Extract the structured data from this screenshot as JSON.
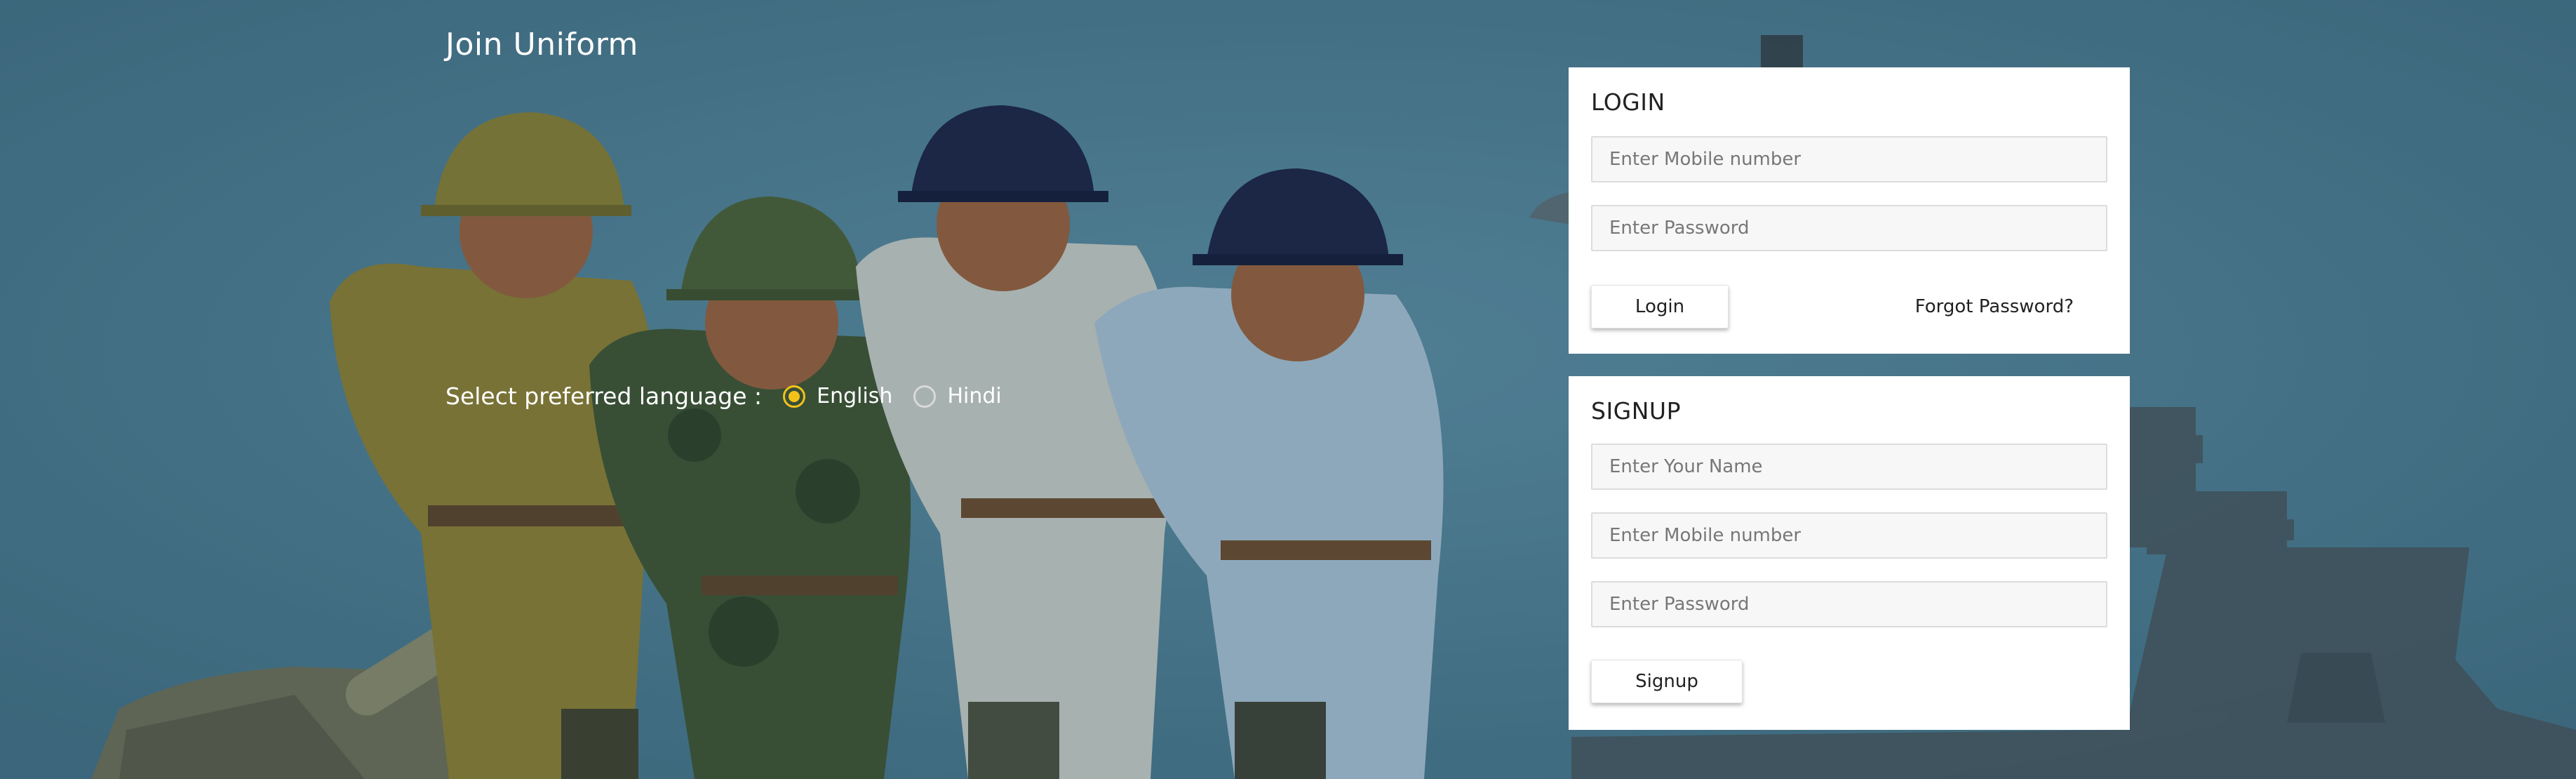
{
  "header": {
    "brand": "Join Uniform"
  },
  "language": {
    "label": "Select preferred language :",
    "options": [
      {
        "label": "English",
        "selected": true
      },
      {
        "label": "Hindi",
        "selected": false
      }
    ],
    "accent_color": "#f2c21b"
  },
  "login": {
    "title": "LOGIN",
    "mobile_placeholder": "Enter Mobile number",
    "password_placeholder": "Enter Password",
    "button_label": "Login",
    "forgot_label": "Forgot Password?"
  },
  "signup": {
    "title": "SIGNUP",
    "name_placeholder": "Enter Your Name",
    "mobile_placeholder": "Enter Mobile number",
    "password_placeholder": "Enter Password",
    "button_label": "Signup"
  },
  "colors": {
    "background": "#4e7a8f",
    "card": "#ffffff"
  }
}
